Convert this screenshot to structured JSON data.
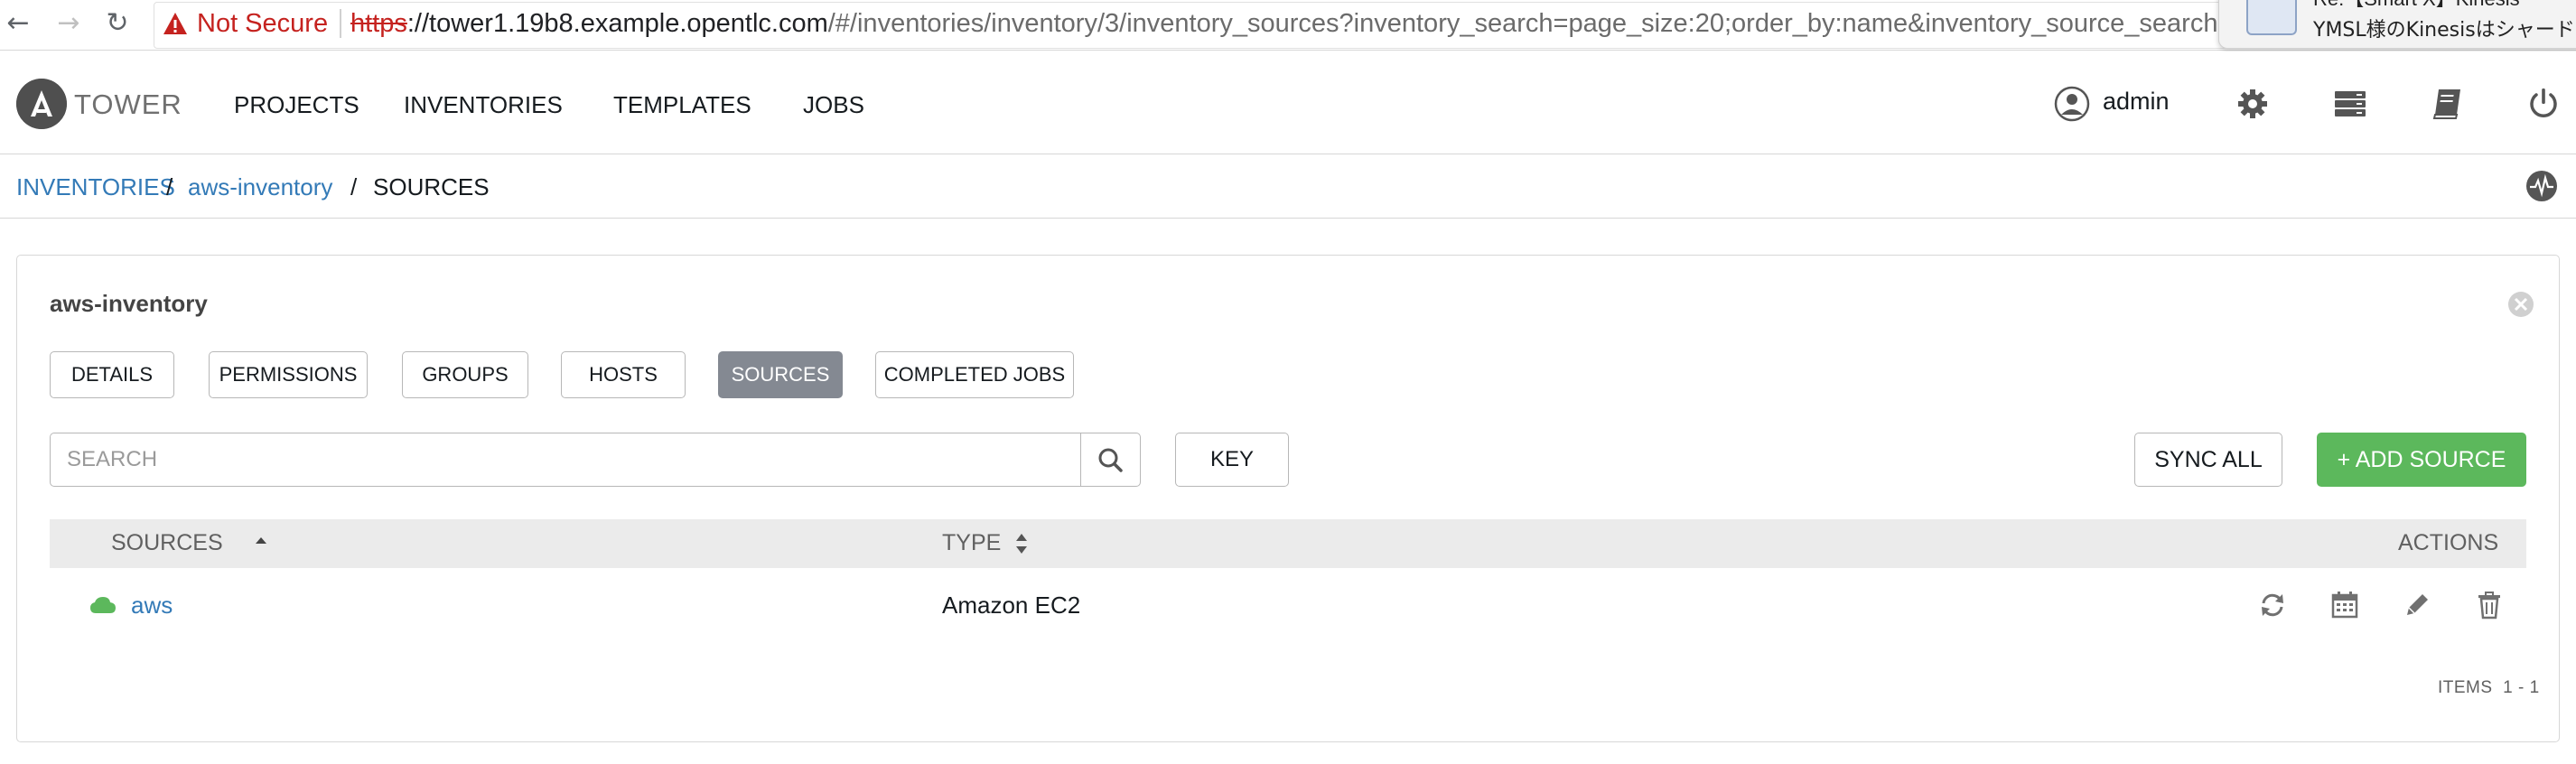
{
  "browser": {
    "not_secure": "Not Secure",
    "url_scheme": "https",
    "url_host": "://tower1.19b8.example.opentlc.com",
    "url_path": "/#/inventories/inventory/3/inventory_sources?inventory_search=page_size:20;order_by:name&inventory_source_search=",
    "notification": {
      "title": "Re:【Smart X】Kinesis",
      "body": "YMSL様のKinesisはシャードが"
    }
  },
  "header": {
    "logo_text": "TOWER",
    "nav": [
      "PROJECTS",
      "INVENTORIES",
      "TEMPLATES",
      "JOBS"
    ],
    "user": "admin",
    "icons": [
      "user-icon",
      "gear-icon",
      "server-icon",
      "book-icon",
      "power-icon"
    ]
  },
  "breadcrumb": {
    "items": [
      "INVENTORIES",
      "aws-inventory",
      "SOURCES"
    ],
    "separator": "/"
  },
  "panel": {
    "title": "aws-inventory",
    "tabs": [
      "DETAILS",
      "PERMISSIONS",
      "GROUPS",
      "HOSTS",
      "SOURCES",
      "COMPLETED JOBS"
    ],
    "active_tab": "SOURCES",
    "search_placeholder": "SEARCH",
    "key_label": "KEY",
    "sync_all_label": "SYNC ALL",
    "add_source_label": "+ ADD SOURCE",
    "columns": [
      "SOURCES",
      "TYPE",
      "ACTIONS"
    ],
    "rows": [
      {
        "name": "aws",
        "type": "Amazon EC2",
        "status_color": "#5cb85c"
      }
    ],
    "items_label": "ITEMS",
    "items_range": "1 - 1"
  },
  "colors": {
    "link": "#337ab7",
    "success": "#5cb85c",
    "active_tab": "#848992",
    "danger": "#c5221f"
  }
}
